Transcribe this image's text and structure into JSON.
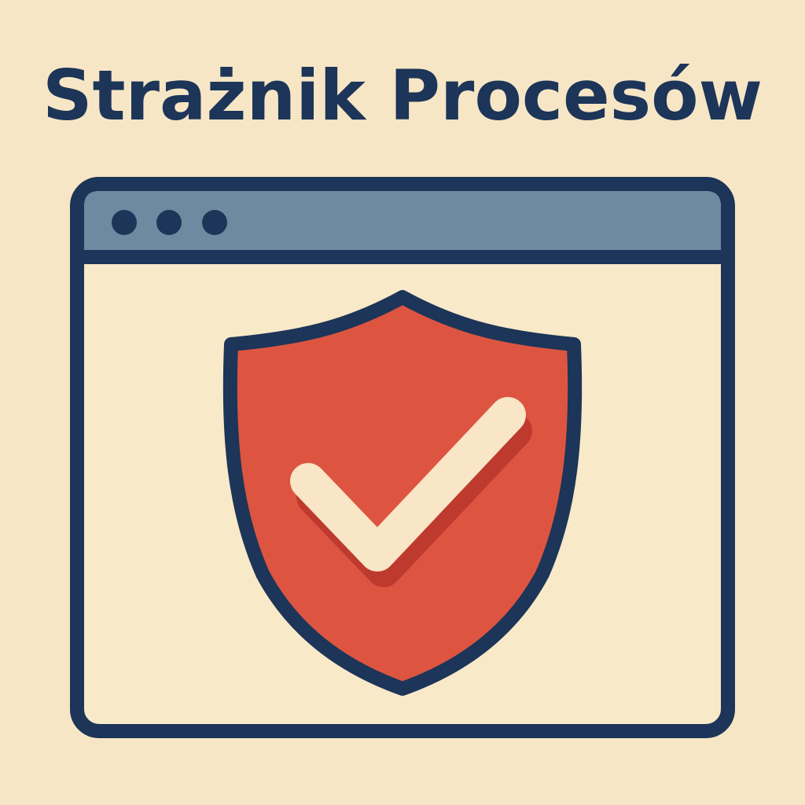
{
  "title": "Strażnik Procesów",
  "colors": {
    "background": "#f7e6c5",
    "window_fill": "#f8e9c9",
    "titlebar": "#6e8aa0",
    "outline": "#1c3558",
    "shield": "#dd5541",
    "shield_shadow": "#bf3a2e",
    "checkmark": "#f8e6c6"
  },
  "window": {
    "controls": [
      "dot-icon",
      "dot-icon",
      "dot-icon"
    ]
  },
  "emblem": {
    "icon": "shield-check-icon"
  }
}
